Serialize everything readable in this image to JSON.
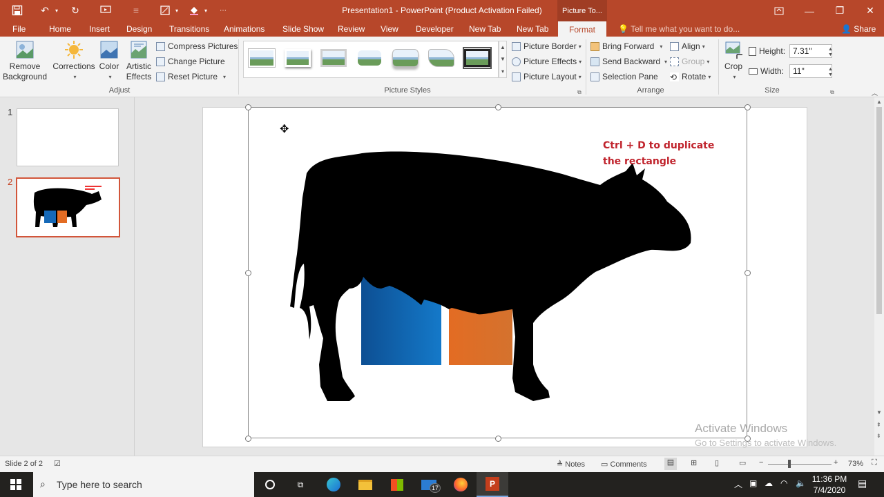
{
  "window": {
    "title": "Presentation1 - PowerPoint (Product Activation Failed)",
    "contextual_tab": "Picture To...",
    "brand_color": "#b7472a"
  },
  "tabs": [
    "File",
    "Home",
    "Insert",
    "Design",
    "Transitions",
    "Animations",
    "Slide Show",
    "Review",
    "View",
    "Developer",
    "New Tab",
    "New Tab",
    "Format"
  ],
  "tell_me": "Tell me what you want to do...",
  "share": "Share",
  "ribbon": {
    "adjust": {
      "remove_background": [
        "Remove",
        "Background"
      ],
      "corrections": "Corrections",
      "color": "Color",
      "artistic_effects": [
        "Artistic",
        "Effects"
      ],
      "compress": "Compress Pictures",
      "change": "Change Picture",
      "reset": "Reset Picture",
      "label": "Adjust"
    },
    "picture_styles": {
      "label": "Picture Styles",
      "border": "Picture Border",
      "effects": "Picture Effects",
      "layout": "Picture Layout"
    },
    "arrange": {
      "label": "Arrange",
      "bring_forward": "Bring Forward",
      "send_backward": "Send Backward",
      "selection_pane": "Selection Pane",
      "align": "Align",
      "group": "Group",
      "rotate": "Rotate"
    },
    "size": {
      "label": "Size",
      "crop": "Crop",
      "height_label": "Height:",
      "height_value": "7.31\"",
      "width_label": "Width:",
      "width_value": "11\""
    }
  },
  "slides": [
    {
      "number": "1"
    },
    {
      "number": "2"
    }
  ],
  "slide_text": [
    "Ctrl + D to duplicate",
    "the rectangle"
  ],
  "watermark": [
    "Activate Windows",
    "Go to Settings to activate Windows."
  ],
  "status": {
    "slide_indicator": "Slide 2 of 2",
    "notes": "Notes",
    "comments": "Comments",
    "zoom": "73%"
  },
  "taskbar": {
    "search_placeholder": "Type here to search",
    "time": "11:36 PM",
    "date": "7/4/2020",
    "mail_badge": "17"
  }
}
